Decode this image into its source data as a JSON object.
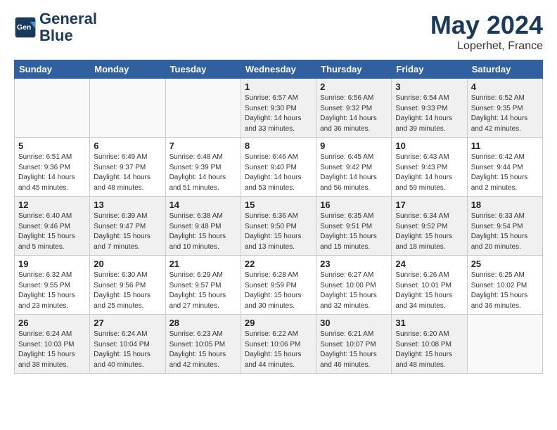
{
  "header": {
    "logo_line1": "General",
    "logo_line2": "Blue",
    "month": "May 2024",
    "location": "Loperhet, France"
  },
  "weekdays": [
    "Sunday",
    "Monday",
    "Tuesday",
    "Wednesday",
    "Thursday",
    "Friday",
    "Saturday"
  ],
  "weeks": [
    [
      {
        "day": "",
        "info": ""
      },
      {
        "day": "",
        "info": ""
      },
      {
        "day": "",
        "info": ""
      },
      {
        "day": "1",
        "info": "Sunrise: 6:57 AM\nSunset: 9:30 PM\nDaylight: 14 hours\nand 33 minutes."
      },
      {
        "day": "2",
        "info": "Sunrise: 6:56 AM\nSunset: 9:32 PM\nDaylight: 14 hours\nand 36 minutes."
      },
      {
        "day": "3",
        "info": "Sunrise: 6:54 AM\nSunset: 9:33 PM\nDaylight: 14 hours\nand 39 minutes."
      },
      {
        "day": "4",
        "info": "Sunrise: 6:52 AM\nSunset: 9:35 PM\nDaylight: 14 hours\nand 42 minutes."
      }
    ],
    [
      {
        "day": "5",
        "info": "Sunrise: 6:51 AM\nSunset: 9:36 PM\nDaylight: 14 hours\nand 45 minutes."
      },
      {
        "day": "6",
        "info": "Sunrise: 6:49 AM\nSunset: 9:37 PM\nDaylight: 14 hours\nand 48 minutes."
      },
      {
        "day": "7",
        "info": "Sunrise: 6:48 AM\nSunset: 9:39 PM\nDaylight: 14 hours\nand 51 minutes."
      },
      {
        "day": "8",
        "info": "Sunrise: 6:46 AM\nSunset: 9:40 PM\nDaylight: 14 hours\nand 53 minutes."
      },
      {
        "day": "9",
        "info": "Sunrise: 6:45 AM\nSunset: 9:42 PM\nDaylight: 14 hours\nand 56 minutes."
      },
      {
        "day": "10",
        "info": "Sunrise: 6:43 AM\nSunset: 9:43 PM\nDaylight: 14 hours\nand 59 minutes."
      },
      {
        "day": "11",
        "info": "Sunrise: 6:42 AM\nSunset: 9:44 PM\nDaylight: 15 hours\nand 2 minutes."
      }
    ],
    [
      {
        "day": "12",
        "info": "Sunrise: 6:40 AM\nSunset: 9:46 PM\nDaylight: 15 hours\nand 5 minutes."
      },
      {
        "day": "13",
        "info": "Sunrise: 6:39 AM\nSunset: 9:47 PM\nDaylight: 15 hours\nand 7 minutes."
      },
      {
        "day": "14",
        "info": "Sunrise: 6:38 AM\nSunset: 9:48 PM\nDaylight: 15 hours\nand 10 minutes."
      },
      {
        "day": "15",
        "info": "Sunrise: 6:36 AM\nSunset: 9:50 PM\nDaylight: 15 hours\nand 13 minutes."
      },
      {
        "day": "16",
        "info": "Sunrise: 6:35 AM\nSunset: 9:51 PM\nDaylight: 15 hours\nand 15 minutes."
      },
      {
        "day": "17",
        "info": "Sunrise: 6:34 AM\nSunset: 9:52 PM\nDaylight: 15 hours\nand 18 minutes."
      },
      {
        "day": "18",
        "info": "Sunrise: 6:33 AM\nSunset: 9:54 PM\nDaylight: 15 hours\nand 20 minutes."
      }
    ],
    [
      {
        "day": "19",
        "info": "Sunrise: 6:32 AM\nSunset: 9:55 PM\nDaylight: 15 hours\nand 23 minutes."
      },
      {
        "day": "20",
        "info": "Sunrise: 6:30 AM\nSunset: 9:56 PM\nDaylight: 15 hours\nand 25 minutes."
      },
      {
        "day": "21",
        "info": "Sunrise: 6:29 AM\nSunset: 9:57 PM\nDaylight: 15 hours\nand 27 minutes."
      },
      {
        "day": "22",
        "info": "Sunrise: 6:28 AM\nSunset: 9:59 PM\nDaylight: 15 hours\nand 30 minutes."
      },
      {
        "day": "23",
        "info": "Sunrise: 6:27 AM\nSunset: 10:00 PM\nDaylight: 15 hours\nand 32 minutes."
      },
      {
        "day": "24",
        "info": "Sunrise: 6:26 AM\nSunset: 10:01 PM\nDaylight: 15 hours\nand 34 minutes."
      },
      {
        "day": "25",
        "info": "Sunrise: 6:25 AM\nSunset: 10:02 PM\nDaylight: 15 hours\nand 36 minutes."
      }
    ],
    [
      {
        "day": "26",
        "info": "Sunrise: 6:24 AM\nSunset: 10:03 PM\nDaylight: 15 hours\nand 38 minutes."
      },
      {
        "day": "27",
        "info": "Sunrise: 6:24 AM\nSunset: 10:04 PM\nDaylight: 15 hours\nand 40 minutes."
      },
      {
        "day": "28",
        "info": "Sunrise: 6:23 AM\nSunset: 10:05 PM\nDaylight: 15 hours\nand 42 minutes."
      },
      {
        "day": "29",
        "info": "Sunrise: 6:22 AM\nSunset: 10:06 PM\nDaylight: 15 hours\nand 44 minutes."
      },
      {
        "day": "30",
        "info": "Sunrise: 6:21 AM\nSunset: 10:07 PM\nDaylight: 15 hours\nand 46 minutes."
      },
      {
        "day": "31",
        "info": "Sunrise: 6:20 AM\nSunset: 10:08 PM\nDaylight: 15 hours\nand 48 minutes."
      },
      {
        "day": "",
        "info": ""
      }
    ]
  ]
}
